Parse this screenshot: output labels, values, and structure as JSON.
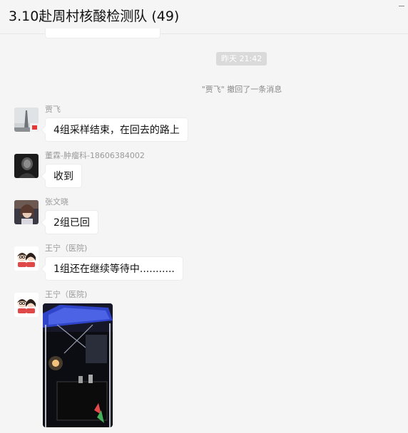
{
  "header": {
    "title": "3.10赴周村核酸检测队 (49)"
  },
  "chat": {
    "timestamp": "昨天 21:42",
    "recall_notice": "\"贾飞\" 撤回了一条消息",
    "messages": [
      {
        "sender": "贾飞",
        "text": "4组采样结束，在回去的路上",
        "avatar": "tower-photo-avatar"
      },
      {
        "sender": "董霖-肿瘤科-18606384002",
        "text": "收到",
        "avatar": "dark-portrait-avatar"
      },
      {
        "sender": "张文晓",
        "text": "2组已回",
        "avatar": "selfie-avatar"
      },
      {
        "sender": "王宁（医院)",
        "text": "1组还在继续等待中...........",
        "avatar": "cartoon-couple-avatar"
      },
      {
        "sender": "王宁（医院)",
        "image": "night-tent-photo",
        "avatar": "cartoon-couple-avatar"
      }
    ]
  }
}
